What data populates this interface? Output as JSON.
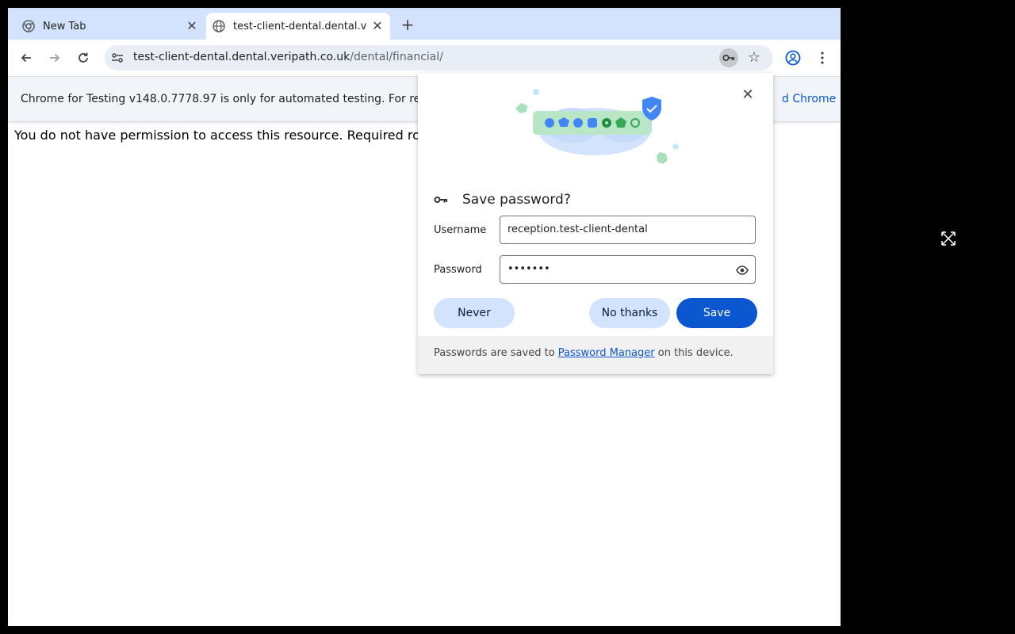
{
  "tabs": [
    {
      "title": "New Tab",
      "icon": "chrome-icon"
    },
    {
      "title": "test-client-dental.dental.veripath.co.uk",
      "icon": "globe-icon"
    }
  ],
  "toolbar": {
    "url_host": "test-client-dental.dental.veripath.co.uk",
    "url_path": "/dental/financial/"
  },
  "infobar": {
    "message": "Chrome for Testing v148.0.7778.97 is only for automated testing. For re",
    "link": "d Chrome"
  },
  "page": {
    "message": "You do not have permission to access this resource. Required ro"
  },
  "dialog": {
    "title": "Save password?",
    "username_label": "Username",
    "username_value": "reception.test-client-dental",
    "password_label": "Password",
    "password_value": "•••••••",
    "never_label": "Never",
    "no_thanks_label": "No thanks",
    "save_label": "Save",
    "footer_prefix": "Passwords are saved to ",
    "footer_link": "Password Manager",
    "footer_suffix": " on this device."
  },
  "colors": {
    "accent": "#0b57d0",
    "tab_strip": "#d3e3fd",
    "tonal_button": "#d3e3fd"
  }
}
